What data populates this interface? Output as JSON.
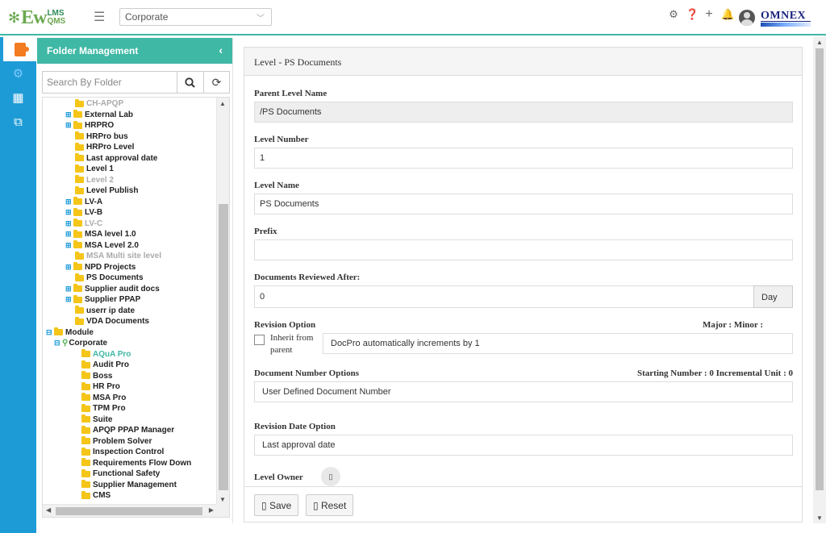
{
  "app": {
    "logo_prefix": "Ew",
    "logo_top": "LMS",
    "logo_bottom": "QMS",
    "hamburger_icon": "menu-icon",
    "site_select": "Corporate",
    "brand": "OMNEX",
    "top_icons": [
      "gear-icon",
      "help-icon",
      "plus-icon",
      "bell-icon"
    ]
  },
  "rail": {
    "items": [
      "document-icon",
      "settings-gears-icon",
      "building-icon",
      "copy-icon"
    ]
  },
  "folder_panel": {
    "title": "Folder Management",
    "search_placeholder": "Search By Folder",
    "tree": [
      {
        "label": "CH-APQP",
        "state": "disabled",
        "expandable": false
      },
      {
        "label": "External Lab",
        "state": "normal",
        "expandable": true
      },
      {
        "label": "HRPRO",
        "state": "normal",
        "expandable": true
      },
      {
        "label": "HRPro bus",
        "state": "normal",
        "expandable": false
      },
      {
        "label": "HRPro Level",
        "state": "normal",
        "expandable": false
      },
      {
        "label": "Last approval date",
        "state": "normal",
        "expandable": false
      },
      {
        "label": "Level 1",
        "state": "normal",
        "expandable": false
      },
      {
        "label": "Level 2",
        "state": "disabled",
        "expandable": false
      },
      {
        "label": "Level Publish",
        "state": "normal",
        "expandable": false
      },
      {
        "label": "LV-A",
        "state": "normal",
        "expandable": true
      },
      {
        "label": "LV-B",
        "state": "normal",
        "expandable": true
      },
      {
        "label": "LV-C",
        "state": "disabled",
        "expandable": true
      },
      {
        "label": "MSA level 1.0",
        "state": "normal",
        "expandable": true
      },
      {
        "label": "MSA Level 2.0",
        "state": "normal",
        "expandable": true
      },
      {
        "label": "MSA Multi site level",
        "state": "disabled",
        "expandable": false
      },
      {
        "label": "NPD Projects",
        "state": "normal",
        "expandable": true
      },
      {
        "label": "PS Documents",
        "state": "normal",
        "expandable": false
      },
      {
        "label": "Supplier audit docs",
        "state": "normal",
        "expandable": true
      },
      {
        "label": "Supplier PPAP",
        "state": "normal",
        "expandable": true
      },
      {
        "label": "userr ip date",
        "state": "normal",
        "expandable": false
      },
      {
        "label": "VDA Documents",
        "state": "normal",
        "expandable": false
      },
      {
        "label": "Module",
        "state": "normal",
        "expandable": true,
        "root": true
      },
      {
        "label": "Corporate",
        "state": "normal",
        "expandable": true,
        "site": true
      },
      {
        "label": "AQuA Pro",
        "state": "highlight",
        "expandable": false
      },
      {
        "label": "Audit Pro",
        "state": "normal",
        "expandable": false
      },
      {
        "label": "Boss",
        "state": "normal",
        "expandable": false
      },
      {
        "label": "HR Pro",
        "state": "normal",
        "expandable": false
      },
      {
        "label": "MSA Pro",
        "state": "normal",
        "expandable": false
      },
      {
        "label": "TPM Pro",
        "state": "normal",
        "expandable": false
      },
      {
        "label": "Suite",
        "state": "normal",
        "expandable": false
      },
      {
        "label": "APQP PPAP Manager",
        "state": "normal",
        "expandable": false
      },
      {
        "label": "Problem Solver",
        "state": "normal",
        "expandable": false
      },
      {
        "label": "Inspection Control",
        "state": "normal",
        "expandable": false
      },
      {
        "label": "Requirements Flow Down",
        "state": "normal",
        "expandable": false
      },
      {
        "label": "Functional Safety",
        "state": "normal",
        "expandable": false
      },
      {
        "label": "Supplier Management",
        "state": "normal",
        "expandable": false
      },
      {
        "label": "CMS",
        "state": "normal",
        "expandable": false
      }
    ]
  },
  "form": {
    "title": "Level - PS Documents",
    "parent_level_label": "Parent Level Name",
    "parent_level_value": "/PS Documents",
    "level_number_label": "Level Number",
    "level_number_value": "1",
    "level_name_label": "Level Name",
    "level_name_value": "PS Documents",
    "prefix_label": "Prefix",
    "prefix_value": "",
    "reviewed_after_label": "Documents Reviewed After:",
    "reviewed_after_value": "0",
    "reviewed_after_unit": "Day",
    "revision_option_label": "Revision Option",
    "major_minor_label": "Major : Minor :",
    "inherit_label": "Inherit from parent",
    "revision_option_value": "DocPro automatically increments by 1",
    "doc_number_label": "Document Number Options",
    "doc_number_meta": "Starting Number : 0 Incremental Unit : 0",
    "doc_number_value": "User Defined Document Number",
    "revision_date_label": "Revision Date Option",
    "revision_date_value": "Last approval date",
    "level_owner_label": "Level Owner",
    "save_label": "Save",
    "reset_label": "Reset"
  },
  "colors": {
    "accent": "#3fb8a5",
    "rail": "#1d9bd6",
    "folder": "#f5c518"
  }
}
